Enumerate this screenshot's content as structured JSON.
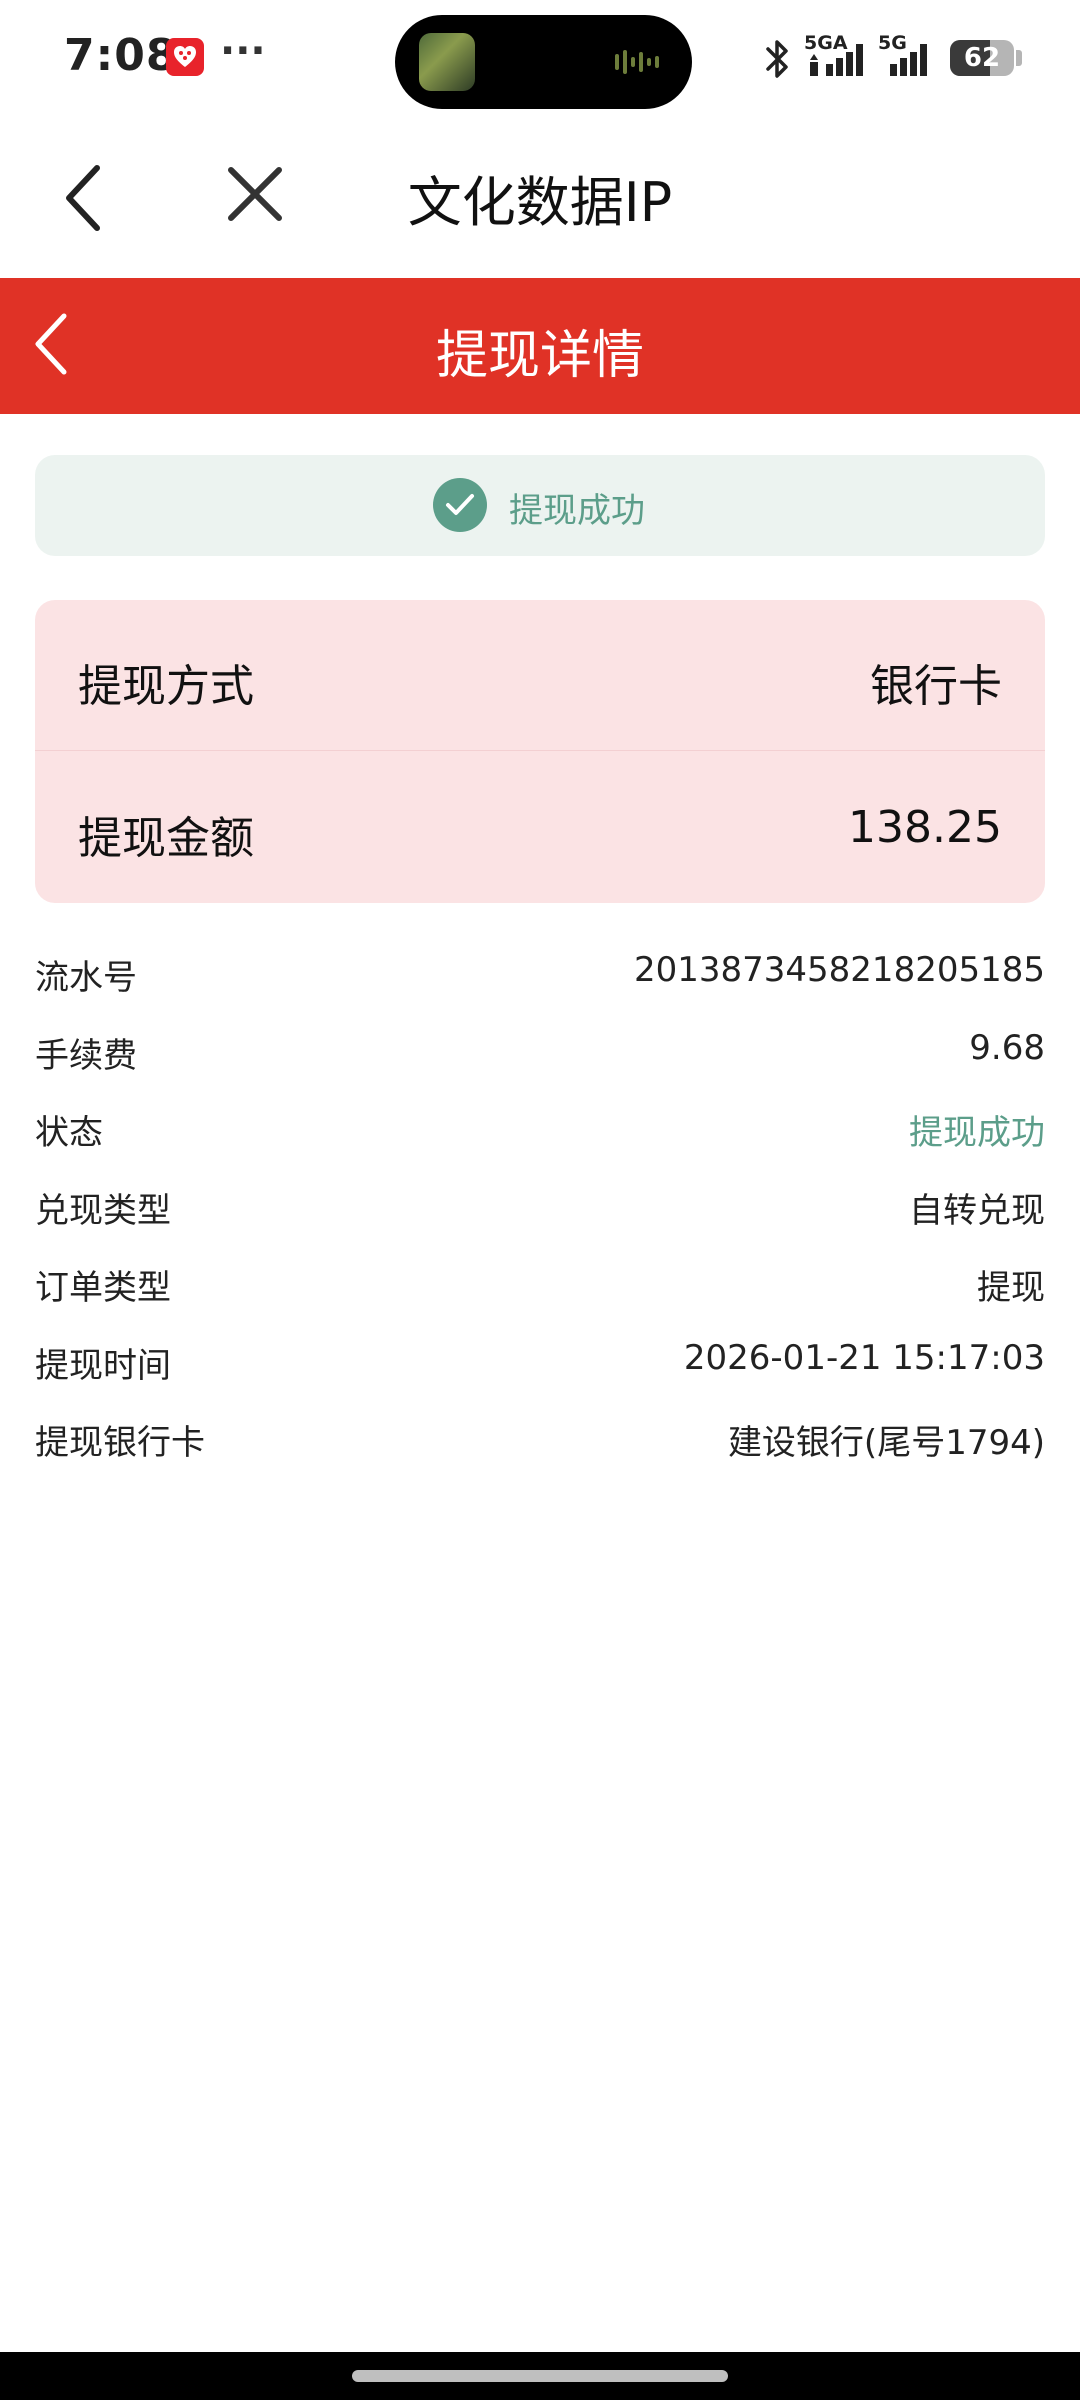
{
  "status_bar": {
    "time": "7:08",
    "more": "···",
    "network_1": "5GA",
    "network_2": "5G",
    "battery": "62",
    "icons": [
      "app-notification-icon",
      "bluetooth-icon",
      "signal-icon",
      "signal-icon",
      "battery-icon"
    ]
  },
  "nav": {
    "title": "文化数据IP",
    "back_icon": "chevron-left-icon",
    "close_icon": "close-icon"
  },
  "header": {
    "title": "提现详情",
    "color": "#e03226"
  },
  "banner": {
    "status_text": "提现成功",
    "color": "#5c9e8a"
  },
  "summary": {
    "method_label": "提现方式",
    "method_value": "银行卡",
    "amount_label": "提现金额",
    "amount_value": "138.25"
  },
  "details": [
    {
      "label": "流水号",
      "value": "2013873458218205185"
    },
    {
      "label": "手续费",
      "value": "9.68"
    },
    {
      "label": "状态",
      "value": "提现成功"
    },
    {
      "label": "兑现类型",
      "value": "自转兑现"
    },
    {
      "label": "订单类型",
      "value": "提现"
    },
    {
      "label": "提现时间",
      "value": "2026-01-21 15:17:03"
    },
    {
      "label": "提现银行卡",
      "value": "建设银行(尾号1794)"
    }
  ]
}
